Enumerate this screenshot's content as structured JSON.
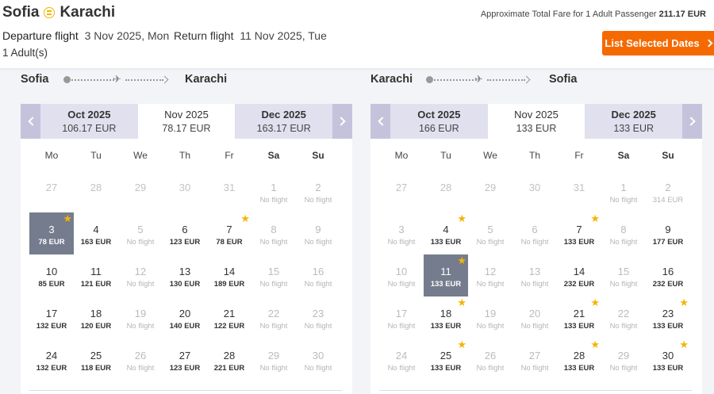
{
  "header": {
    "origin": "Sofia",
    "destination": "Karachi",
    "fare_label": "Approximate Total Fare for 1 Adult Passenger",
    "fare_value": "211.17 EUR",
    "departure_label": "Departure flight",
    "departure_date": "3 Nov 2025, Mon",
    "return_label": "Return flight",
    "return_date": "11 Nov 2025, Tue",
    "passengers": "1 Adult(s)",
    "list_button": "List Selected Dates",
    "accent_color": "#f56a00"
  },
  "weekdays": [
    "Mo",
    "Tu",
    "We",
    "Th",
    "Fr",
    "Sa",
    "Su"
  ],
  "legs": [
    {
      "from": "Sofia",
      "to": "Karachi",
      "months": [
        {
          "name": "Oct 2025",
          "price": "106.17 EUR"
        },
        {
          "name": "Nov 2025",
          "price": "78.17 EUR",
          "active": true
        },
        {
          "name": "Dec 2025",
          "price": "163.17 EUR"
        }
      ],
      "days": [
        {
          "d": "27",
          "s": "out"
        },
        {
          "d": "28",
          "s": "out"
        },
        {
          "d": "29",
          "s": "out"
        },
        {
          "d": "30",
          "s": "out"
        },
        {
          "d": "31",
          "s": "out"
        },
        {
          "d": "1",
          "p": "No flight",
          "s": "nf"
        },
        {
          "d": "2",
          "p": "No flight",
          "s": "nf"
        },
        {
          "d": "3",
          "p": "78 EUR",
          "s": "sel",
          "star": true
        },
        {
          "d": "4",
          "p": "163 EUR"
        },
        {
          "d": "5",
          "p": "No flight",
          "s": "nf"
        },
        {
          "d": "6",
          "p": "123 EUR"
        },
        {
          "d": "7",
          "p": "78 EUR",
          "star": true
        },
        {
          "d": "8",
          "p": "No flight",
          "s": "nf"
        },
        {
          "d": "9",
          "p": "No flight",
          "s": "nf"
        },
        {
          "d": "10",
          "p": "85 EUR"
        },
        {
          "d": "11",
          "p": "121 EUR"
        },
        {
          "d": "12",
          "p": "No flight",
          "s": "nf"
        },
        {
          "d": "13",
          "p": "130 EUR"
        },
        {
          "d": "14",
          "p": "189 EUR"
        },
        {
          "d": "15",
          "p": "No flight",
          "s": "nf"
        },
        {
          "d": "16",
          "p": "No flight",
          "s": "nf"
        },
        {
          "d": "17",
          "p": "132 EUR"
        },
        {
          "d": "18",
          "p": "120 EUR"
        },
        {
          "d": "19",
          "p": "No flight",
          "s": "nf"
        },
        {
          "d": "20",
          "p": "140 EUR"
        },
        {
          "d": "21",
          "p": "122 EUR"
        },
        {
          "d": "22",
          "p": "No flight",
          "s": "nf"
        },
        {
          "d": "23",
          "p": "No flight",
          "s": "nf"
        },
        {
          "d": "24",
          "p": "132 EUR"
        },
        {
          "d": "25",
          "p": "118 EUR"
        },
        {
          "d": "26",
          "p": "No flight",
          "s": "nf"
        },
        {
          "d": "27",
          "p": "123 EUR"
        },
        {
          "d": "28",
          "p": "221 EUR"
        },
        {
          "d": "29",
          "p": "No flight",
          "s": "nf"
        },
        {
          "d": "30",
          "p": "No flight",
          "s": "nf"
        }
      ]
    },
    {
      "from": "Karachi",
      "to": "Sofia",
      "months": [
        {
          "name": "Oct 2025",
          "price": "166 EUR"
        },
        {
          "name": "Nov 2025",
          "price": "133 EUR",
          "active": true
        },
        {
          "name": "Dec 2025",
          "price": "133 EUR"
        }
      ],
      "days": [
        {
          "d": "27",
          "s": "out"
        },
        {
          "d": "28",
          "s": "out"
        },
        {
          "d": "29",
          "s": "out"
        },
        {
          "d": "30",
          "s": "out"
        },
        {
          "d": "31",
          "s": "out"
        },
        {
          "d": "1",
          "p": "No flight",
          "s": "nf"
        },
        {
          "d": "2",
          "p": "314 EUR",
          "s": "nf"
        },
        {
          "d": "3",
          "p": "No flight",
          "s": "nf"
        },
        {
          "d": "4",
          "p": "133 EUR",
          "star": true
        },
        {
          "d": "5",
          "p": "No flight",
          "s": "nf"
        },
        {
          "d": "6",
          "p": "No flight",
          "s": "nf"
        },
        {
          "d": "7",
          "p": "133 EUR",
          "star": true
        },
        {
          "d": "8",
          "p": "No flight",
          "s": "nf"
        },
        {
          "d": "9",
          "p": "177 EUR"
        },
        {
          "d": "10",
          "p": "No flight",
          "s": "nf"
        },
        {
          "d": "11",
          "p": "133 EUR",
          "s": "sel",
          "star": true
        },
        {
          "d": "12",
          "p": "No flight",
          "s": "nf"
        },
        {
          "d": "13",
          "p": "No flight",
          "s": "nf"
        },
        {
          "d": "14",
          "p": "232 EUR"
        },
        {
          "d": "15",
          "p": "No flight",
          "s": "nf"
        },
        {
          "d": "16",
          "p": "232 EUR"
        },
        {
          "d": "17",
          "p": "No flight",
          "s": "nf"
        },
        {
          "d": "18",
          "p": "133 EUR",
          "star": true
        },
        {
          "d": "19",
          "p": "No flight",
          "s": "nf"
        },
        {
          "d": "20",
          "p": "No flight",
          "s": "nf"
        },
        {
          "d": "21",
          "p": "133 EUR",
          "star": true
        },
        {
          "d": "22",
          "p": "No flight",
          "s": "nf"
        },
        {
          "d": "23",
          "p": "133 EUR",
          "star": true
        },
        {
          "d": "24",
          "p": "No flight",
          "s": "nf"
        },
        {
          "d": "25",
          "p": "133 EUR",
          "star": true
        },
        {
          "d": "26",
          "p": "No flight",
          "s": "nf"
        },
        {
          "d": "27",
          "p": "No flight",
          "s": "nf"
        },
        {
          "d": "28",
          "p": "133 EUR",
          "star": true
        },
        {
          "d": "29",
          "p": "No flight",
          "s": "nf"
        },
        {
          "d": "30",
          "p": "133 EUR",
          "star": true
        }
      ]
    }
  ]
}
